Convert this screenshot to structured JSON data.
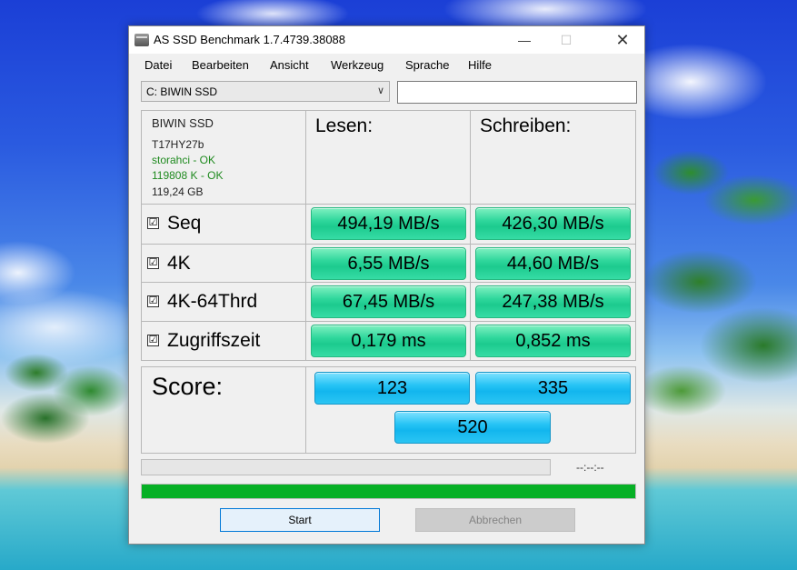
{
  "window": {
    "title": "AS SSD Benchmark 1.7.4739.38088"
  },
  "menu": [
    "Datei",
    "Bearbeiten",
    "Ansicht",
    "Werkzeug",
    "Sprache",
    "Hilfe"
  ],
  "drive": {
    "selected": "C: BIWIN SSD",
    "side_value": ""
  },
  "info": {
    "model": "BIWIN SSD",
    "firmware": "T17HY27b",
    "driver": "storahci - OK",
    "alignment": "119808 K - OK",
    "size": "119,24 GB"
  },
  "headers": {
    "read": "Lesen:",
    "write": "Schreiben:"
  },
  "tests": [
    {
      "label": "Seq",
      "checked": true,
      "read": "494,19 MB/s",
      "write": "426,30 MB/s"
    },
    {
      "label": "4K",
      "checked": true,
      "read": "6,55 MB/s",
      "write": "44,60 MB/s"
    },
    {
      "label": "4K-64Thrd",
      "checked": true,
      "read": "67,45 MB/s",
      "write": "247,38 MB/s"
    },
    {
      "label": "Zugriffszeit",
      "checked": true,
      "read": "0,179 ms",
      "write": "0,852 ms"
    }
  ],
  "checkmark": "☑",
  "score": {
    "label": "Score:",
    "read": "123",
    "write": "335",
    "total": "520"
  },
  "progress": {
    "time": "--:--:--",
    "fraction_top": 0,
    "fraction_bottom": 1.0
  },
  "buttons": {
    "start": "Start",
    "abort": "Abbrechen"
  },
  "colors": {
    "value_box": "#2fd79c",
    "score_box": "#27c4f5",
    "progress": "#06b025",
    "ok_text": "#1f8a1f"
  }
}
